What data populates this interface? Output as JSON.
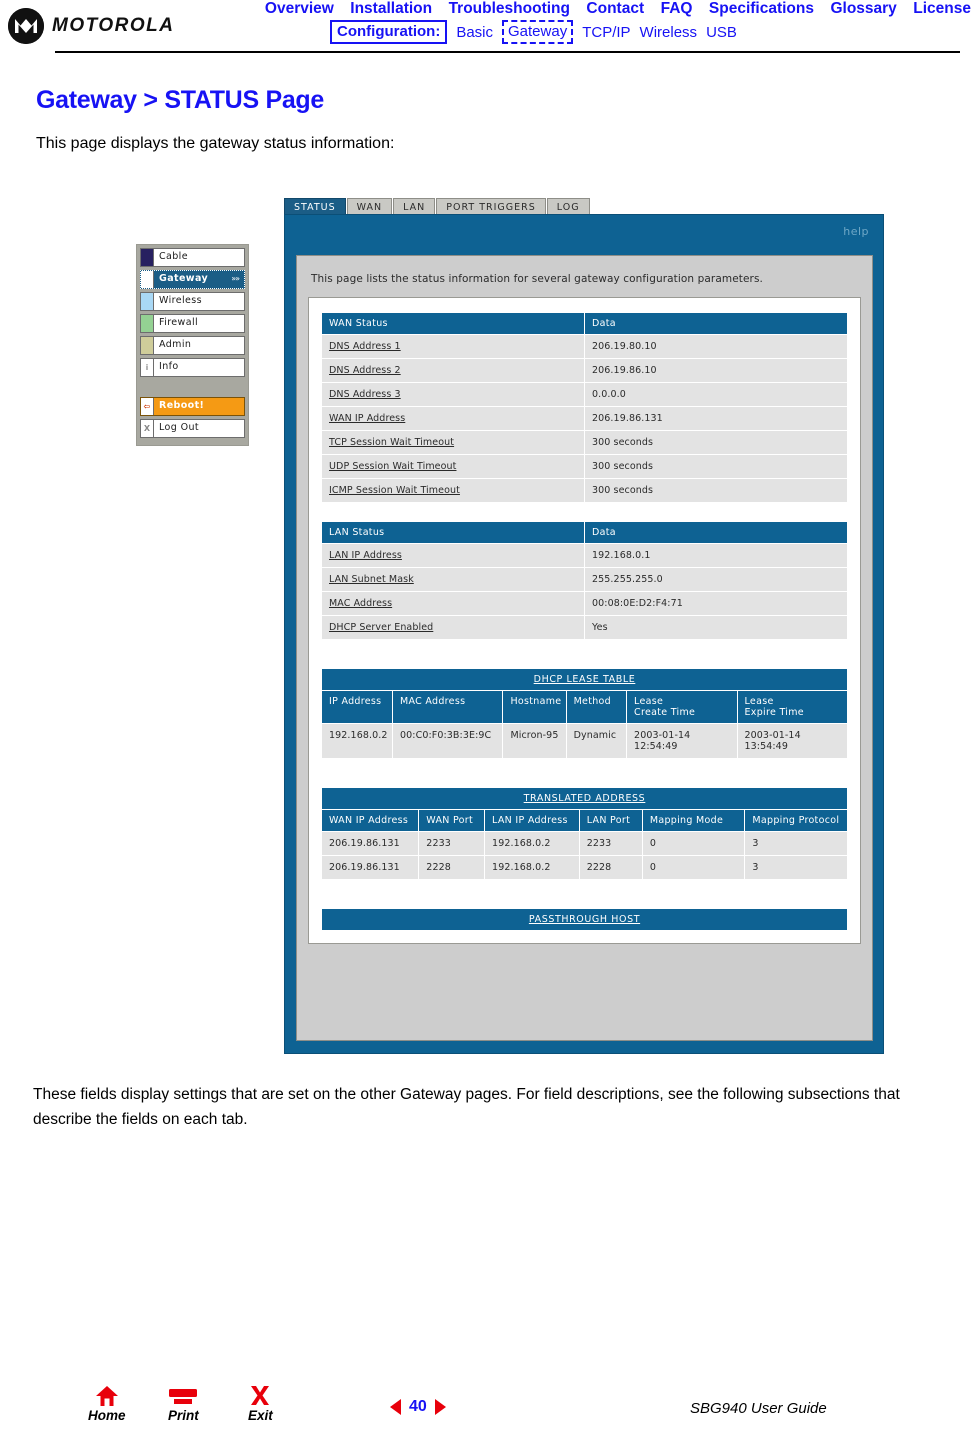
{
  "header": {
    "brand": "MOTOROLA",
    "logo_icon": "motorola-m-icon",
    "primary_links": [
      "Overview",
      "Installation",
      "Troubleshooting",
      "Contact",
      "FAQ",
      "Specifications",
      "Glossary",
      "License"
    ],
    "config_label": "Configuration:",
    "config_links": [
      "Basic",
      "Gateway",
      "TCP/IP",
      "Wireless",
      "USB"
    ],
    "config_current": "Gateway",
    "link_color": "#1712f4"
  },
  "page": {
    "title": "Gateway > STATUS Page",
    "intro": "This page displays the gateway status information:",
    "outro": "These fields display settings that are set on the other Gateway pages. For field descriptions, see the following subsections that describe the fields on each tab."
  },
  "router": {
    "menu": [
      {
        "label": "Cable",
        "swatch": "",
        "selected": false,
        "arrow": ""
      },
      {
        "label": "Gateway",
        "swatch": "",
        "selected": true,
        "arrow": "»»"
      },
      {
        "label": "Wireless",
        "swatch": "",
        "selected": false,
        "arrow": ""
      },
      {
        "label": "Firewall",
        "swatch": "",
        "selected": false,
        "arrow": ""
      },
      {
        "label": "Admin",
        "swatch": "",
        "selected": false,
        "arrow": ""
      },
      {
        "label": "Info",
        "swatch": "i",
        "selected": false,
        "arrow": ""
      }
    ],
    "menu_actions": [
      {
        "label": "Reboot!",
        "swatch": "⇦"
      },
      {
        "label": "Log Out",
        "swatch": "X"
      }
    ],
    "tabs": [
      "STATUS",
      "WAN",
      "LAN",
      "PORT TRIGGERS",
      "LOG"
    ],
    "active_tab": "STATUS",
    "help_label": "help",
    "panel_note": "This page lists the status information for several gateway configuration parameters.",
    "accent_color": "#0e6293",
    "wan_status": {
      "headers": [
        "WAN Status",
        "Data"
      ],
      "rows": [
        [
          "DNS Address 1",
          "206.19.80.10"
        ],
        [
          "DNS Address 2",
          "206.19.86.10"
        ],
        [
          "DNS Address 3",
          "0.0.0.0"
        ],
        [
          "WAN IP Address",
          "206.19.86.131"
        ],
        [
          "TCP Session Wait Timeout",
          "300 seconds"
        ],
        [
          "UDP Session Wait Timeout",
          "300 seconds"
        ],
        [
          "ICMP Session Wait Timeout",
          "300 seconds"
        ]
      ]
    },
    "lan_status": {
      "headers": [
        "LAN Status",
        "Data"
      ],
      "rows": [
        [
          "LAN IP Address",
          "192.168.0.1"
        ],
        [
          "LAN Subnet Mask",
          "255.255.255.0"
        ],
        [
          "MAC Address",
          "00:08:0E:D2:F4:71"
        ],
        [
          "DHCP Server Enabled",
          "Yes"
        ]
      ]
    },
    "dhcp_lease_table": {
      "banner": "DHCP LEASE TABLE",
      "headers": [
        "IP Address",
        "MAC Address",
        "Hostname",
        "Method",
        "Lease\nCreate Time",
        "Lease\nExpire Time"
      ],
      "headers_line1": [
        "IP Address",
        "MAC Address",
        "Hostname",
        "Method",
        "Lease",
        "Lease"
      ],
      "headers_line2": [
        "",
        "",
        "",
        "",
        "Create Time",
        "Expire Time"
      ],
      "rows": [
        [
          "192.168.0.2",
          "00:C0:F0:3B:3E:9C",
          "Micron-95",
          "Dynamic",
          "2003-01-14 12:54:49",
          "2003-01-14 13:54:49"
        ]
      ],
      "rows_split": [
        [
          "192.168.0.2",
          "00:C0:F0:3B:3E:9C",
          "Micron-95",
          "Dynamic",
          "2003-01-14",
          "12:54:49",
          "2003-01-14",
          "13:54:49"
        ]
      ]
    },
    "translated_address": {
      "banner": "TRANSLATED ADDRESS",
      "headers": [
        "WAN IP Address",
        "WAN Port",
        "LAN IP Address",
        "LAN Port",
        "Mapping Mode",
        "Mapping Protocol"
      ],
      "rows": [
        [
          "206.19.86.131",
          "2233",
          "192.168.0.2",
          "2233",
          "0",
          "3"
        ],
        [
          "206.19.86.131",
          "2228",
          "192.168.0.2",
          "2228",
          "0",
          "3"
        ]
      ]
    },
    "passthrough_host": {
      "banner": "PASSTHROUGH HOST"
    }
  },
  "footer": {
    "nav": [
      {
        "label": "Home",
        "icon": "home-icon"
      },
      {
        "label": "Print",
        "icon": "printer-icon"
      },
      {
        "label": "Exit",
        "icon": "x-icon"
      }
    ],
    "page_number": "40",
    "prev_icon": "left-arrow-icon",
    "next_icon": "right-arrow-icon",
    "guide_title": "SBG940 User Guide"
  }
}
